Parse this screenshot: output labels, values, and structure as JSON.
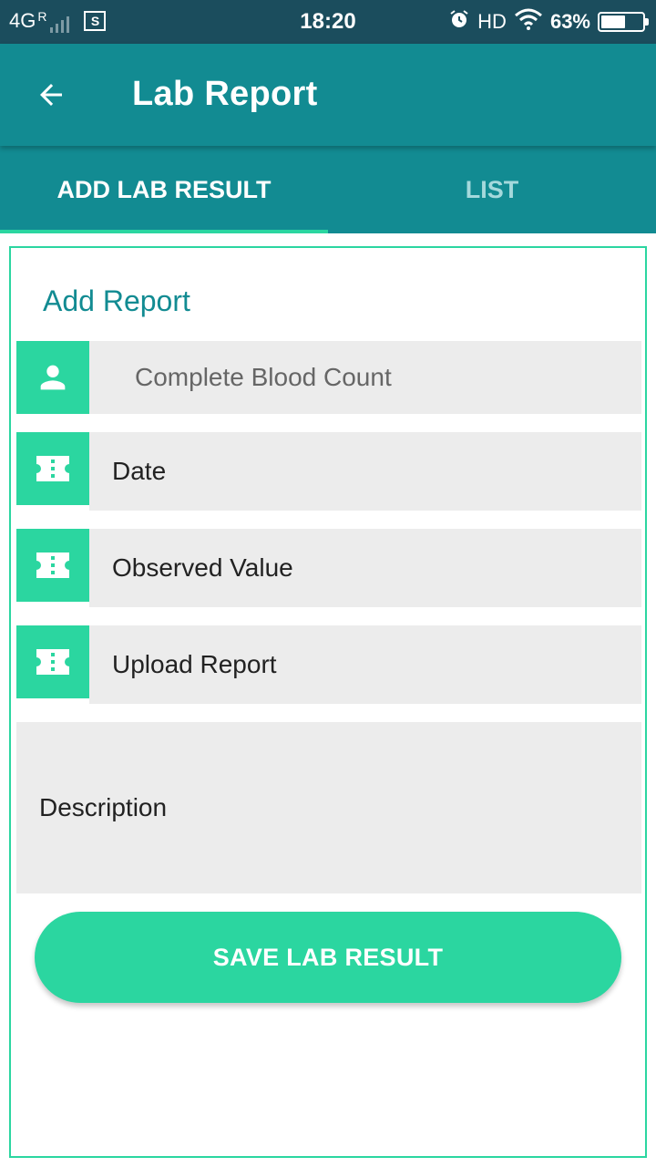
{
  "status_bar": {
    "network": "4G",
    "roaming": "R",
    "sim_icon": "S",
    "time": "18:20",
    "hd": "HD",
    "battery": "63%",
    "battery_level": 0.63
  },
  "app_bar": {
    "back_icon": "arrow-left",
    "title": "Lab Report"
  },
  "tabs": [
    {
      "label": "ADD LAB RESULT",
      "active": true
    },
    {
      "label": "LIST",
      "active": false
    }
  ],
  "form": {
    "title": "Add Report",
    "test_select": {
      "value": "Complete Blood Count",
      "icon": "person-icon"
    },
    "date": {
      "placeholder": "Date",
      "icon": "ticket-icon"
    },
    "observed_value": {
      "placeholder": "Observed Value",
      "icon": "ticket-icon"
    },
    "upload_report": {
      "placeholder": "Upload Report",
      "icon": "ticket-icon"
    },
    "description": {
      "placeholder": "Description"
    },
    "save_label": "SAVE LAB RESULT"
  },
  "colors": {
    "status_bar": "#1b4d5d",
    "primary": "#128b92",
    "accent": "#2bd6a0",
    "field_bg": "#ececec"
  }
}
